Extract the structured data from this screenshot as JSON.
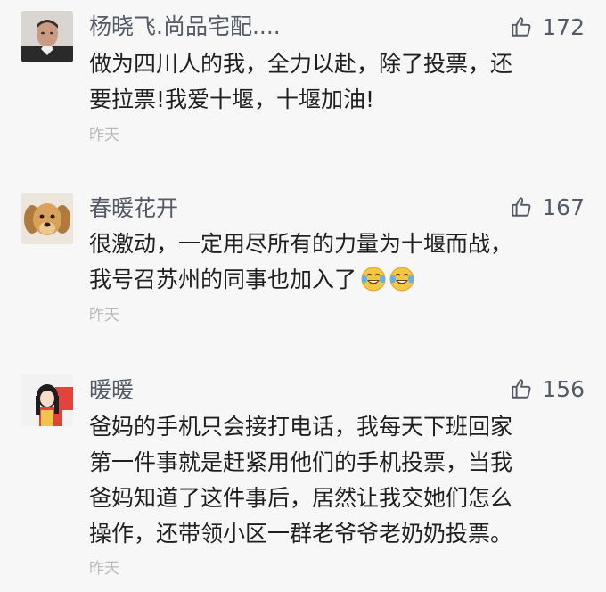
{
  "comments": [
    {
      "username": "杨晓飞.尚品宅配....",
      "likes": "172",
      "lines": [
        "做为四川人的我，全力以赴，除了投票，还",
        "要拉票!我爱十堰，十堰加油!"
      ],
      "time": "昨天",
      "avatar_icon": "man-portrait-avatar-icon"
    },
    {
      "username": "春暖花开",
      "likes": "167",
      "lines": [
        "很激动，一定用尽所有的力量为十堰而战，",
        "我号召苏州的同事也加入了"
      ],
      "emojis": [
        "laugh-cry-emoji-icon",
        "laugh-cry-emoji-icon"
      ],
      "time": "昨天",
      "avatar_icon": "puppy-avatar-icon"
    },
    {
      "username": "暖暖",
      "likes": "156",
      "lines": [
        "爸妈的手机只会接打电话，我每天下班回家",
        "第一件事就是赶紧用他们的手机投票，当我",
        "爸妈知道了这件事后，居然让我交她们怎么",
        "操作，还带领小区一群老爷爷老奶奶投票。"
      ],
      "time": "昨天",
      "avatar_icon": "cartoon-girl-avatar-icon"
    }
  ],
  "colors": {
    "background": "#f7f7f7",
    "username": "#555b66",
    "text": "#1f1f1f",
    "time": "#b8b8b8"
  },
  "icons": {
    "like": "thumbs-up-icon"
  }
}
